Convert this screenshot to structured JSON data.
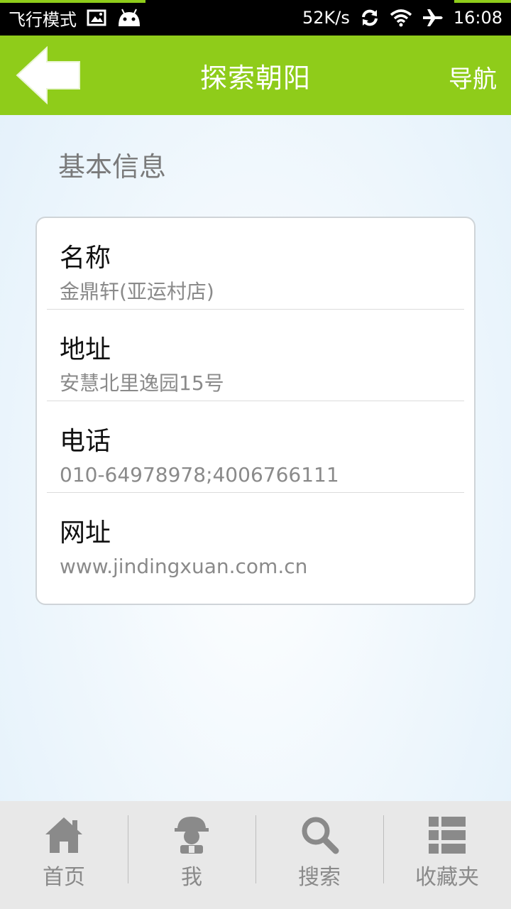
{
  "status_bar": {
    "airplane_mode_label": "飞行模式",
    "speed": "52K/s",
    "time": "16:08",
    "icons": [
      "image-icon",
      "android-icon",
      "sync-icon",
      "wifi-icon",
      "airplane-icon"
    ]
  },
  "header": {
    "title": "探索朝阳",
    "nav_label": "导航",
    "accent_color": "#8fcc1a"
  },
  "section": {
    "title": "基本信息"
  },
  "info": {
    "rows": [
      {
        "label": "名称",
        "value": "金鼎轩(亚运村店)"
      },
      {
        "label": "地址",
        "value": "安慧北里逸园15号"
      },
      {
        "label": "电话",
        "value": "010-64978978;4006766111"
      },
      {
        "label": "网址",
        "value": "www.jindingxuan.com.cn"
      }
    ]
  },
  "bottom_nav": {
    "tabs": [
      {
        "label": "首页",
        "icon": "home-icon"
      },
      {
        "label": "我",
        "icon": "user-icon"
      },
      {
        "label": "搜索",
        "icon": "search-icon"
      },
      {
        "label": "收藏夹",
        "icon": "list-icon"
      }
    ]
  }
}
